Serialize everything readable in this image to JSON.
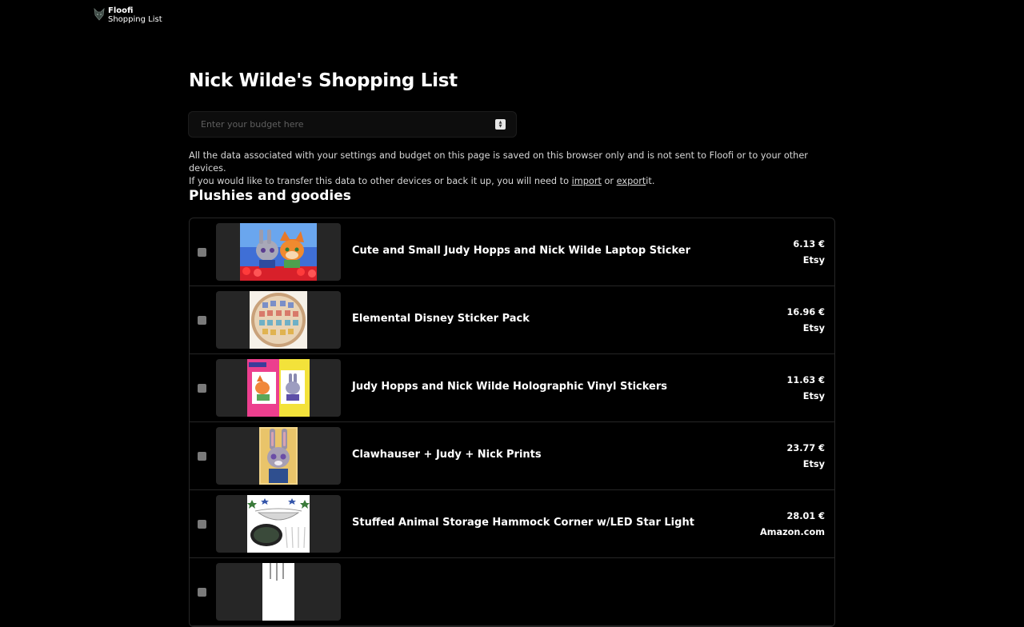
{
  "header": {
    "brand_name": "Floofi",
    "brand_sub": "Shopping List",
    "logo_icon": "fox-head-icon"
  },
  "page": {
    "title": "Nick Wilde's Shopping List"
  },
  "budget": {
    "placeholder": "Enter your budget here",
    "value": ""
  },
  "notice": {
    "line1": "All the data associated with your settings and budget on this page is saved on this browser only and is not sent to Floofi or to your other devices.",
    "line2_prefix": "If you would like to transfer this data to other devices or back it up, you will need to",
    "import_link": "import",
    "or_text": "or",
    "export_link": "export",
    "line2_suffix": "it."
  },
  "section": {
    "title": "Plushies and goodies"
  },
  "items": [
    {
      "name": "Cute and Small Judy Hopps and Nick Wilde Laptop Sticker",
      "price": "6.13 €",
      "store": "Etsy"
    },
    {
      "name": "Elemental Disney Sticker Pack",
      "price": "16.96 €",
      "store": "Etsy"
    },
    {
      "name": "Judy Hopps and Nick Wilde Holographic Vinyl Stickers",
      "price": "11.63 €",
      "store": "Etsy"
    },
    {
      "name": "Clawhauser + Judy + Nick Prints",
      "price": "23.77 €",
      "store": "Etsy"
    },
    {
      "name": "Stuffed Animal Storage Hammock Corner w/LED Star Light",
      "price": "28.01 €",
      "store": "Amazon.com"
    },
    {
      "name": "",
      "price": "",
      "store": ""
    }
  ],
  "colors": {
    "background": "#000000",
    "text": "#ffffff",
    "border": "#262626",
    "thumb_bg": "#262626"
  }
}
